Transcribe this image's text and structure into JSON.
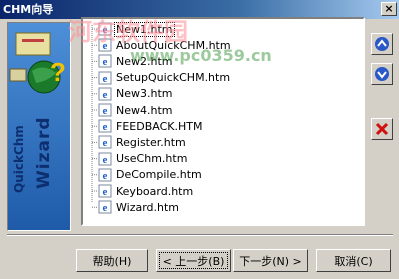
{
  "window": {
    "title": "CHM向导",
    "close_label": "×"
  },
  "sidebar": {
    "brand_text": "Wizard",
    "brand_sub": "QuickChm"
  },
  "file_list": {
    "items": [
      "New1.htm",
      "AboutQuickCHM.htm",
      "New2.htm",
      "SetupQuickCHM.htm",
      "New3.htm",
      "New4.htm",
      "FEEDBACK.HTM",
      "Register.htm",
      "UseChm.htm",
      "DeCompile.htm",
      "Keyboard.htm",
      "Wizard.htm"
    ],
    "selected_index": 0
  },
  "side_buttons": {
    "up_icon": "arrow-up-icon",
    "down_icon": "arrow-down-icon",
    "delete_icon": "delete-x-icon"
  },
  "buttons": {
    "help": "帮助(H)",
    "back": "< 上一步(B)",
    "next": "下一步(N) >",
    "cancel": "取消(C)"
  },
  "watermark": {
    "line1": "河东软件园",
    "line2": "www.pc0359.cn"
  }
}
